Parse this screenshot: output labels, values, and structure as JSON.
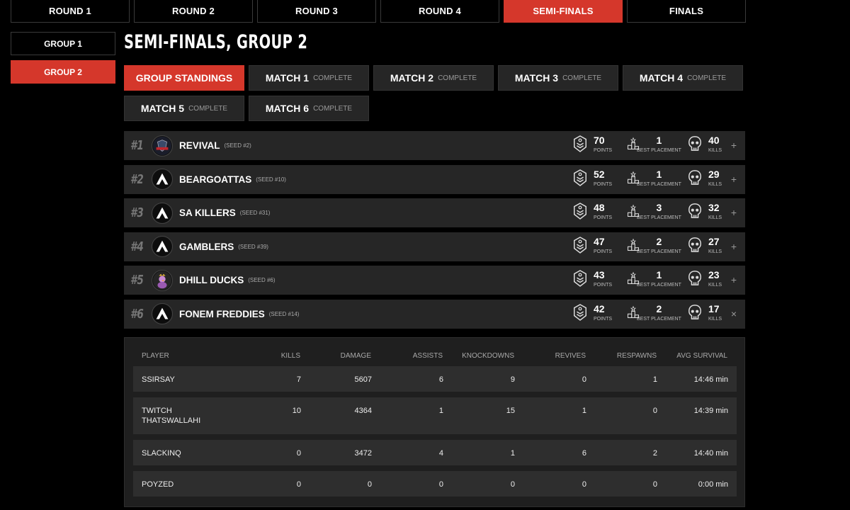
{
  "round_tabs": [
    {
      "label": "ROUND 1",
      "active": false
    },
    {
      "label": "ROUND 2",
      "active": false
    },
    {
      "label": "ROUND 3",
      "active": false
    },
    {
      "label": "ROUND 4",
      "active": false
    },
    {
      "label": "SEMI-FINALS",
      "active": true
    },
    {
      "label": "FINALS",
      "active": false
    }
  ],
  "group_tabs": [
    {
      "label": "GROUP 1",
      "active": false
    },
    {
      "label": "GROUP 2",
      "active": true
    }
  ],
  "page_title": "SEMI-FINALS, GROUP 2",
  "match_tabs": [
    [
      {
        "label": "GROUP STANDINGS",
        "status": "",
        "active": true
      },
      {
        "label": "MATCH 1",
        "status": "COMPLETE",
        "active": false
      },
      {
        "label": "MATCH 2",
        "status": "COMPLETE",
        "active": false
      },
      {
        "label": "MATCH 3",
        "status": "COMPLETE",
        "active": false
      },
      {
        "label": "MATCH 4",
        "status": "COMPLETE",
        "active": false
      }
    ],
    [
      {
        "label": "MATCH 5",
        "status": "COMPLETE",
        "active": false
      },
      {
        "label": "MATCH 6",
        "status": "COMPLETE",
        "active": false
      }
    ]
  ],
  "stat_captions": {
    "points": "POINTS",
    "best_placement": "BEST PLACEMENT",
    "kills": "KILLS"
  },
  "teams": [
    {
      "rank": "#1",
      "name": "REVIVAL",
      "seed": "(SEED #2)",
      "points": "70",
      "best_placement": "1",
      "kills": "40",
      "logo": "revival-logo",
      "toggle": "+"
    },
    {
      "rank": "#2",
      "name": "BEARGOATTAS",
      "seed": "(SEED #10)",
      "points": "52",
      "best_placement": "1",
      "kills": "29",
      "logo": "apex-logo",
      "toggle": "+"
    },
    {
      "rank": "#3",
      "name": "SA KILLERS",
      "seed": "(SEED #31)",
      "points": "48",
      "best_placement": "3",
      "kills": "32",
      "logo": "apex-logo",
      "toggle": "+"
    },
    {
      "rank": "#4",
      "name": "GAMBLERS",
      "seed": "(SEED #39)",
      "points": "47",
      "best_placement": "2",
      "kills": "27",
      "logo": "apex-logo",
      "toggle": "+"
    },
    {
      "rank": "#5",
      "name": "DHILL DUCKS",
      "seed": "(SEED #6)",
      "points": "43",
      "best_placement": "1",
      "kills": "23",
      "logo": "duck-logo",
      "toggle": "+"
    },
    {
      "rank": "#6",
      "name": "FONEM FREDDIES",
      "seed": "(SEED #14)",
      "points": "42",
      "best_placement": "2",
      "kills": "17",
      "logo": "apex-logo",
      "toggle": "×"
    }
  ],
  "player_table": {
    "headers": [
      "PLAYER",
      "KILLS",
      "DAMAGE",
      "ASSISTS",
      "KNOCKDOWNS",
      "REVIVES",
      "RESPAWNS",
      "AVG SURVIVAL"
    ],
    "rows": [
      [
        "SSIRSAY",
        "7",
        "5607",
        "6",
        "9",
        "0",
        "1",
        "14:46 min"
      ],
      [
        "TWITCH THATSWALLAHI",
        "10",
        "4364",
        "1",
        "15",
        "1",
        "0",
        "14:39 min"
      ],
      [
        "SLACKINQ",
        "0",
        "3472",
        "4",
        "1",
        "6",
        "2",
        "14:40 min"
      ],
      [
        "POYZED",
        "0",
        "0",
        "0",
        "0",
        "0",
        "0",
        "0:00 min"
      ]
    ]
  },
  "colors": {
    "accent": "#d5372b",
    "row_bg": "#262626"
  }
}
